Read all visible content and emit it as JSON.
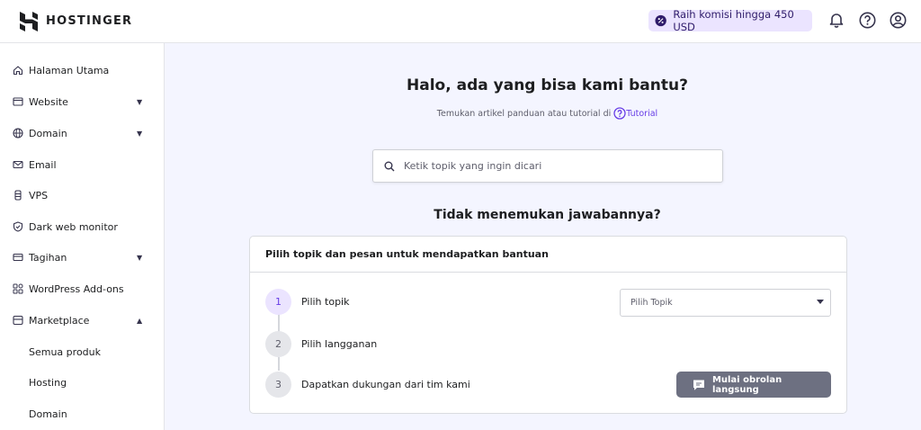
{
  "header": {
    "brand": "HOSTINGER",
    "promo_text": "Raih komisi hingga 450 USD",
    "icons": [
      "bell-icon",
      "help-circle-icon",
      "account-icon"
    ]
  },
  "sidebar": {
    "items": [
      {
        "label": "Halaman Utama",
        "icon": "home-icon",
        "caret": ""
      },
      {
        "label": "Website",
        "icon": "browser-icon",
        "caret": "▼"
      },
      {
        "label": "Domain",
        "icon": "globe-icon",
        "caret": "▼"
      },
      {
        "label": "Email",
        "icon": "mail-icon",
        "caret": ""
      },
      {
        "label": "VPS",
        "icon": "server-icon",
        "caret": ""
      },
      {
        "label": "Dark web monitor",
        "icon": "shield-icon",
        "caret": ""
      },
      {
        "label": "Tagihan",
        "icon": "card-icon",
        "caret": "▼"
      },
      {
        "label": "WordPress Add-ons",
        "icon": "grid-icon",
        "caret": ""
      },
      {
        "label": "Marketplace",
        "icon": "store-icon",
        "caret": "▲"
      }
    ],
    "subitems": [
      {
        "label": "Semua produk"
      },
      {
        "label": "Hosting"
      },
      {
        "label": "Domain"
      }
    ]
  },
  "help": {
    "title": "Halo, ada yang bisa kami bantu?",
    "subtitle_prefix": "Temukan artikel panduan atau tutorial di",
    "tutorial_link": "Tutorial",
    "search_placeholder": "Ketik topik yang ingin dicari",
    "not_found_title": "Tidak menemukan jawabannya?"
  },
  "support_card": {
    "title": "Pilih topik dan pesan untuk mendapatkan bantuan",
    "steps": [
      {
        "number": "1",
        "label": "Pilih topik"
      },
      {
        "number": "2",
        "label": "Pilih langganan"
      },
      {
        "number": "3",
        "label": "Dapatkan dukungan dari tim kami"
      }
    ],
    "topic_select_placeholder": "Pilih Topik",
    "chat_button": "Mulai obrolan langsung"
  },
  "colors": {
    "accent": "#673de6",
    "background": "#f4f5ff",
    "button_disabled": "#6d7081"
  }
}
